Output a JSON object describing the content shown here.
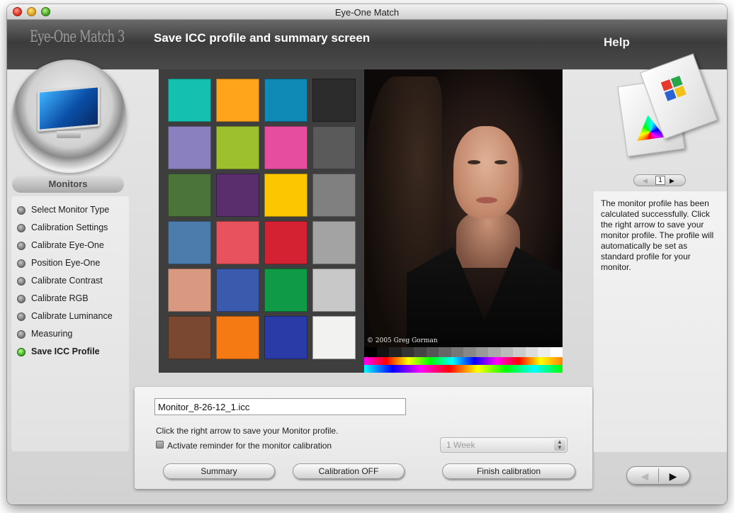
{
  "window": {
    "title": "Eye-One Match"
  },
  "header": {
    "logo": "Eye-One Match 3",
    "screen_title": "Save ICC profile and summary screen",
    "help_title": "Help"
  },
  "sidebar": {
    "section_label": "Monitors",
    "steps": [
      {
        "label": "Select Monitor Type",
        "active": false
      },
      {
        "label": "Calibration Settings",
        "active": false
      },
      {
        "label": "Calibrate Eye-One",
        "active": false
      },
      {
        "label": "Position Eye-One",
        "active": false
      },
      {
        "label": "Calibrate Contrast",
        "active": false
      },
      {
        "label": "Calibrate RGB",
        "active": false
      },
      {
        "label": "Calibrate Luminance",
        "active": false
      },
      {
        "label": "Measuring",
        "active": false
      },
      {
        "label": "Save ICC Profile",
        "active": true
      }
    ]
  },
  "preview": {
    "copyright": "© 2005 Greg Gorman",
    "color_patches": [
      [
        "#14c0b0",
        "#ffa41b",
        "#0f8ab6",
        "#2c2c2c"
      ],
      [
        "#8a7fbf",
        "#9cc12c",
        "#e64d9e",
        "#5a5a5a"
      ],
      [
        "#4a7439",
        "#5a2e6d",
        "#fcc600",
        "#808080"
      ],
      [
        "#4c7cab",
        "#e8525f",
        "#d52232",
        "#a3a3a3"
      ],
      [
        "#d99880",
        "#3a5aae",
        "#0f9a48",
        "#c8c8c8"
      ],
      [
        "#7a4730",
        "#f57a14",
        "#2a3aa6",
        "#f2f2f0"
      ]
    ],
    "gray_steps": [
      "#000000",
      "#111111",
      "#222222",
      "#333333",
      "#444444",
      "#555555",
      "#666666",
      "#777777",
      "#888888",
      "#999999",
      "#aaaaaa",
      "#bbbbbb",
      "#cccccc",
      "#dddddd",
      "#eeeeee",
      "#ffffff"
    ]
  },
  "form": {
    "profile_filename": "Monitor_8-26-12_1.icc",
    "hint": "Click the right arrow to save your Monitor profile.",
    "reminder_label": "Activate reminder for the monitor calibration",
    "reminder_interval": "1 Week",
    "buttons": {
      "summary": "Summary",
      "calibration_off": "Calibration OFF",
      "finish": "Finish calibration"
    }
  },
  "help": {
    "page_number": "1",
    "text": "The monitor profile has been calculated successfully. Click the right arrow to save your monitor profile. The profile will automatically be set as standard profile for your monitor.",
    "icon_colors": [
      "#e53b2d",
      "#2aa54a",
      "#2a62d1",
      "#f2c21a"
    ]
  },
  "navigation": {
    "prev_icon": "left-arrow-icon",
    "next_icon": "right-arrow-icon"
  }
}
